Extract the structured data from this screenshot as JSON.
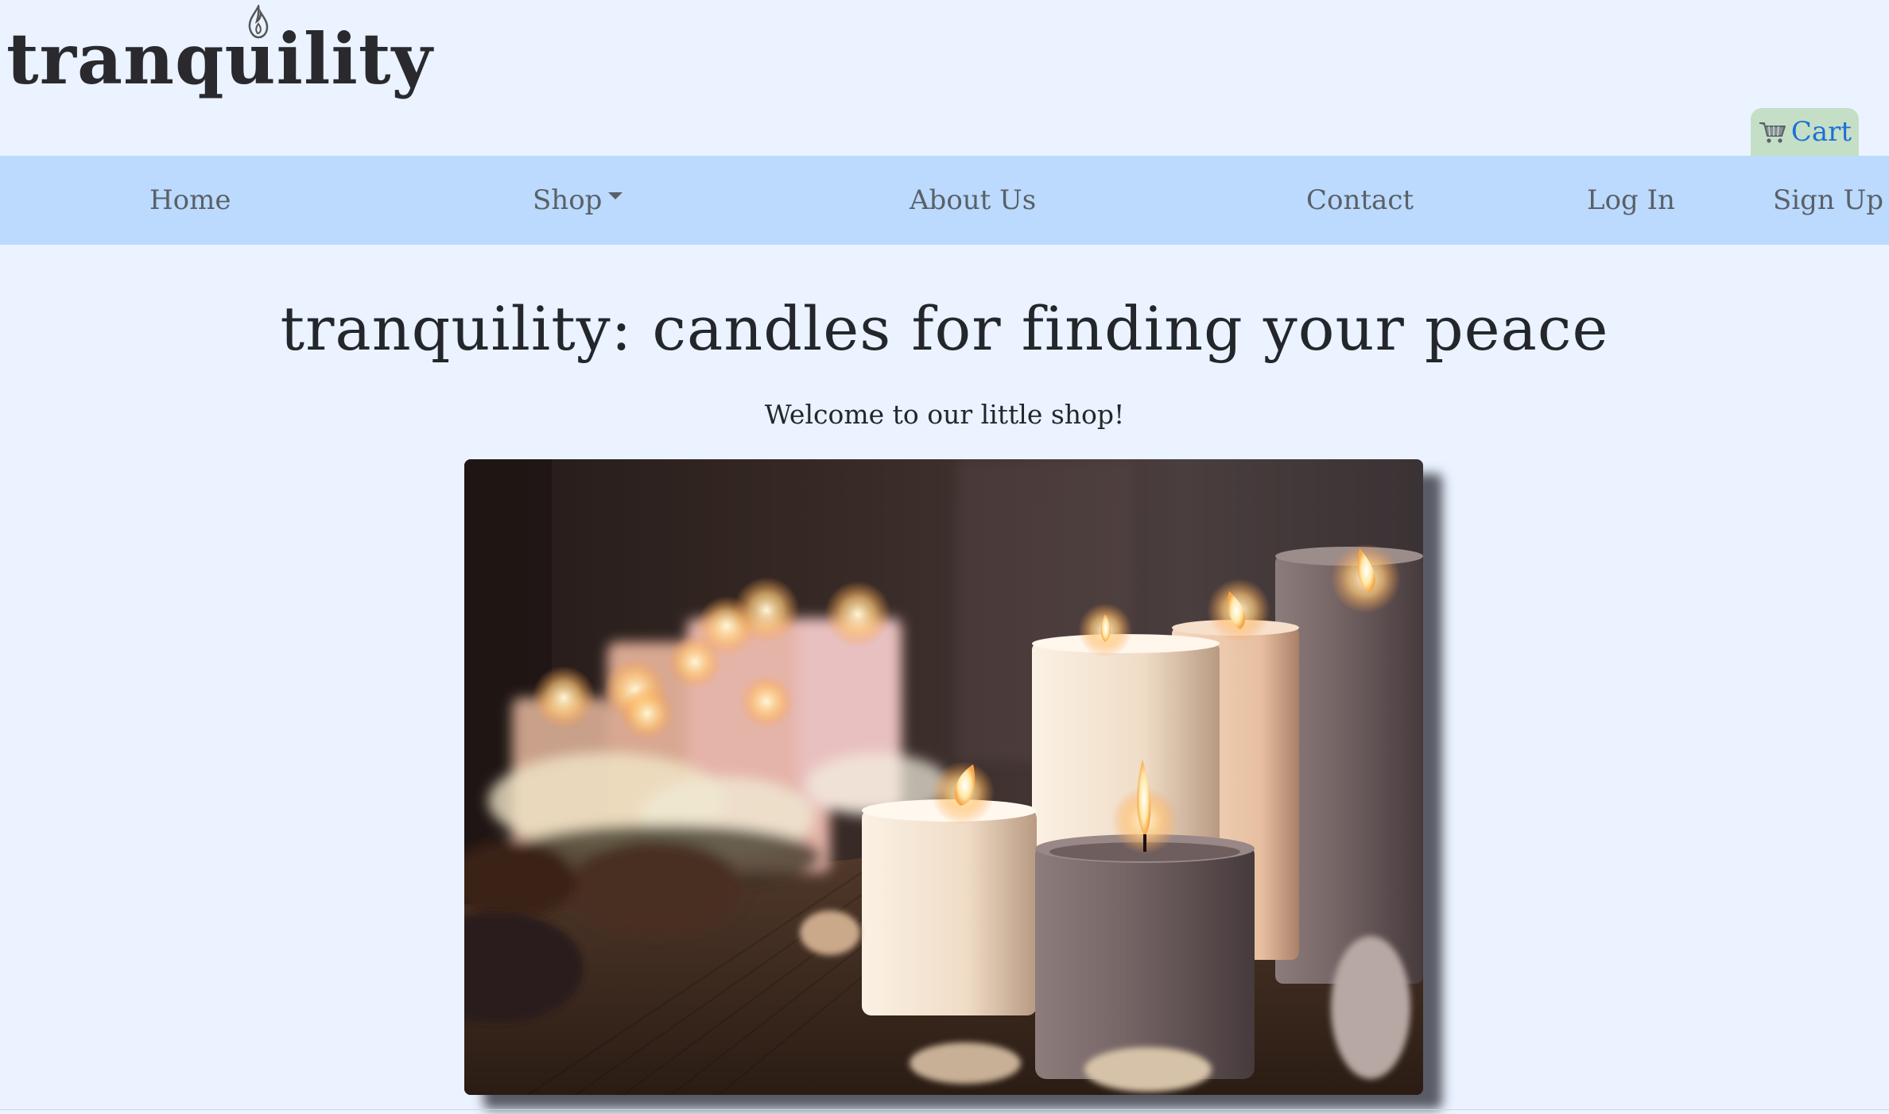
{
  "header": {
    "logo_text": "tranquility",
    "cart_label": "Cart",
    "cart_icon": "cart-icon"
  },
  "nav": {
    "items": [
      {
        "label": "Home"
      },
      {
        "label": "Shop",
        "has_dropdown": true
      },
      {
        "label": "About Us"
      },
      {
        "label": "Contact"
      },
      {
        "label": "Log In"
      },
      {
        "label": "Sign Up"
      }
    ]
  },
  "hero": {
    "title": "tranquility: candles for finding your peace",
    "subtitle": "Welcome to our little shop!",
    "image_label": "candles photo"
  },
  "colors": {
    "page_bg": "#eaf3ff",
    "nav_bg": "#bbdafd",
    "cart_bg": "#c4dfc6",
    "cart_text": "#1f6fd6",
    "nav_text": "#5a6068"
  }
}
